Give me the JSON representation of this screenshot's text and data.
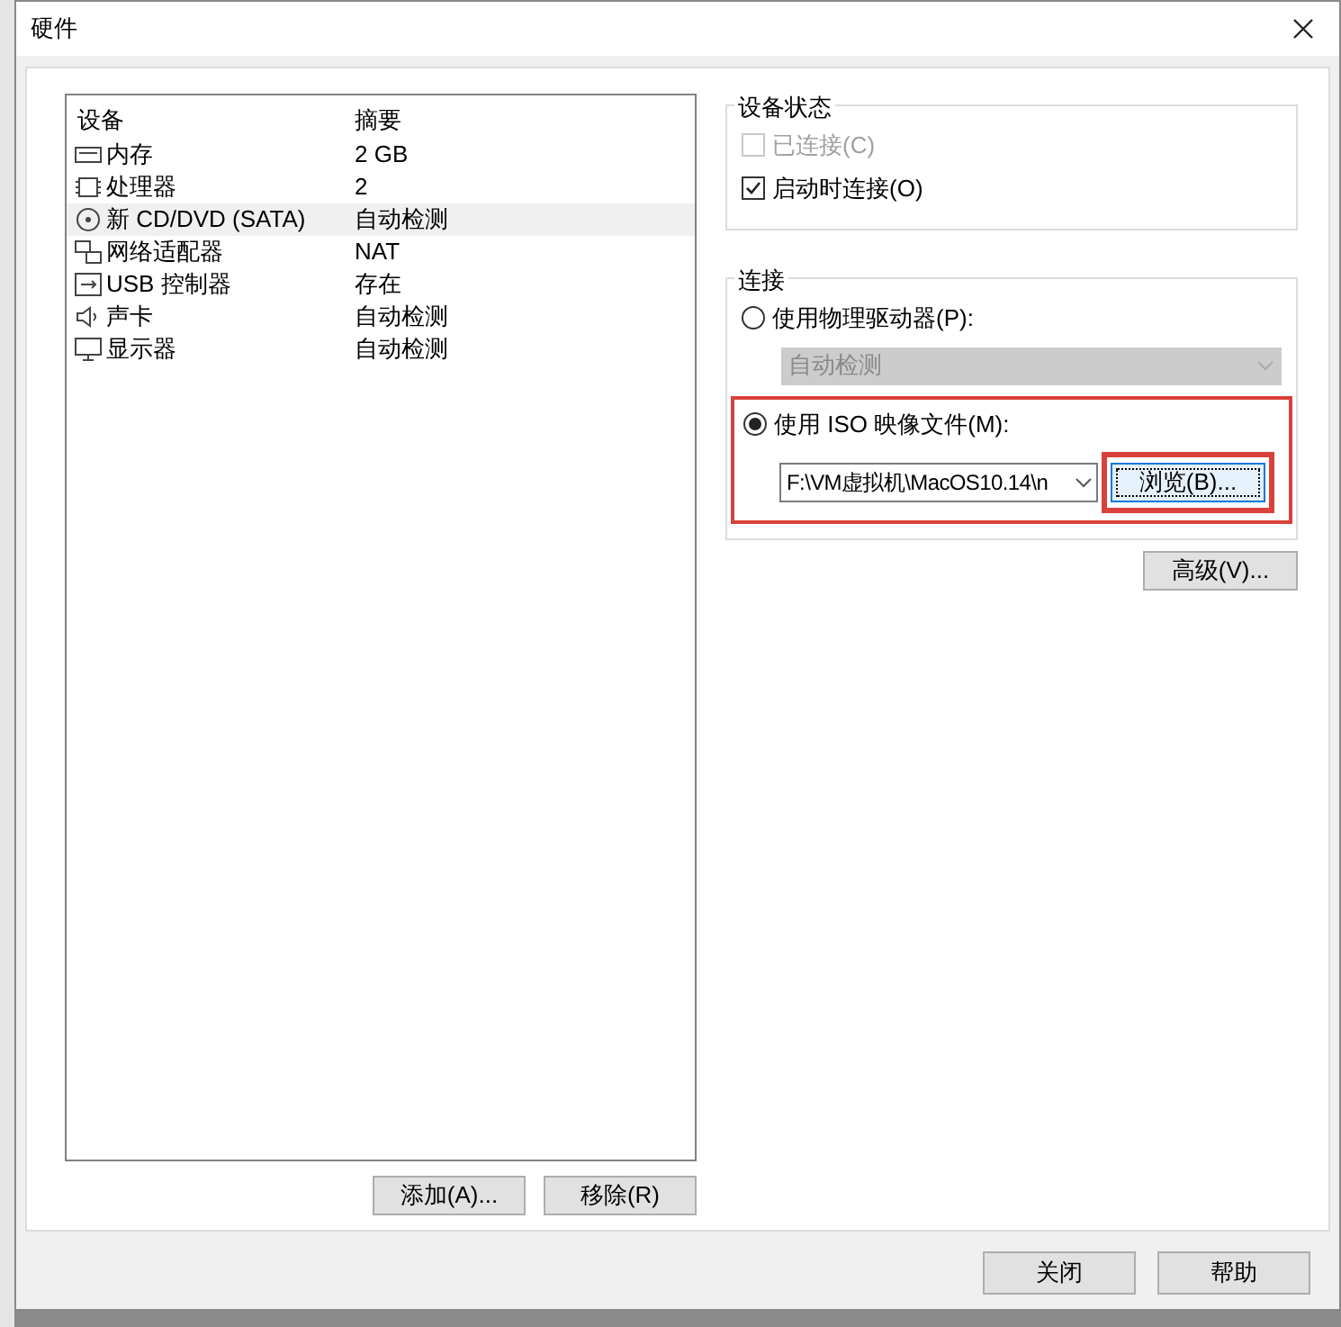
{
  "window": {
    "title": "硬件"
  },
  "device_table": {
    "columns": [
      "设备",
      "摘要"
    ],
    "rows": [
      {
        "kind": "memory",
        "device": "内存",
        "summary": "2 GB",
        "selected": false
      },
      {
        "kind": "cpu",
        "device": "处理器",
        "summary": "2",
        "selected": false
      },
      {
        "kind": "disc",
        "device": "新 CD/DVD (SATA)",
        "summary": "自动检测",
        "selected": true
      },
      {
        "kind": "network",
        "device": "网络适配器",
        "summary": "NAT",
        "selected": false
      },
      {
        "kind": "usb",
        "device": "USB 控制器",
        "summary": "存在",
        "selected": false
      },
      {
        "kind": "sound",
        "device": "声卡",
        "summary": "自动检测",
        "selected": false
      },
      {
        "kind": "display",
        "device": "显示器",
        "summary": "自动检测",
        "selected": false
      }
    ]
  },
  "list_buttons": [
    "添加(A)...",
    "移除(R)"
  ],
  "device_status": {
    "title": "设备状态",
    "checkboxes": [
      {
        "label": "已连接(C)",
        "checked": false,
        "disabled": true
      },
      {
        "label": "启动时连接(O)",
        "checked": true,
        "disabled": false
      }
    ]
  },
  "connection": {
    "title": "连接",
    "physical": {
      "label": "使用物理驱动器(P):",
      "selected": false,
      "dropdown": "自动检测"
    },
    "iso": {
      "label": "使用 ISO 映像文件(M):",
      "selected": true,
      "highlighted": true,
      "path": "F:\\VM虚拟机\\MacOS10.14\\n",
      "browse": "浏览(B)...",
      "browse_highlighted": true
    }
  },
  "advanced_button": "高级(V)...",
  "footer_buttons": [
    "关闭",
    "帮助"
  ]
}
